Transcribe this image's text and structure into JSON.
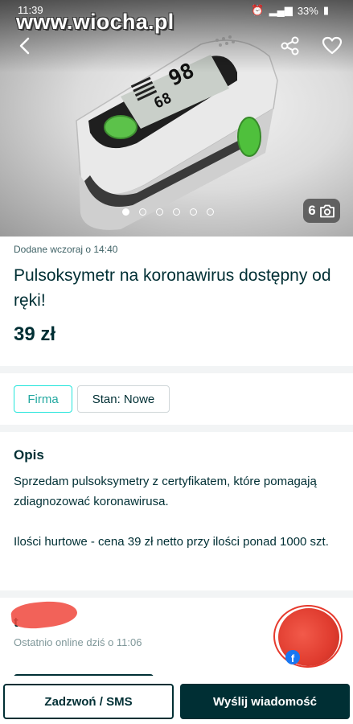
{
  "status_bar": {
    "time": "11:39",
    "battery": "33%"
  },
  "watermark": "www.wiocha.pl",
  "gallery": {
    "photo_count": "6",
    "dots_total": 6,
    "active_dot": 1
  },
  "listing": {
    "added": "Dodane wczoraj o 14:40",
    "title": "Pulsoksymetr na koronawirus dostępny od ręki!",
    "price": "39 zł"
  },
  "tags": {
    "business": "Firma",
    "condition": "Stan: Nowe"
  },
  "description": {
    "heading": "Opis",
    "paragraph1": "Sprzedam pulsoksymetry z certyfikatem, które pomagają zdiagnozować koronawirusa.",
    "paragraph2": "Ilości hurtowe - cena 39 zł netto przy ilości ponad 1000 szt."
  },
  "seller": {
    "name": "t",
    "last_online": "Ostatnio online dziś o 11:06"
  },
  "actions": {
    "call_label": "Zadzwoń / SMS",
    "message_label": "Wyślij wiadomość"
  },
  "colors": {
    "brand_dark": "#002f34",
    "accent_teal": "#23e5db",
    "separator": "#f2f4f5"
  }
}
